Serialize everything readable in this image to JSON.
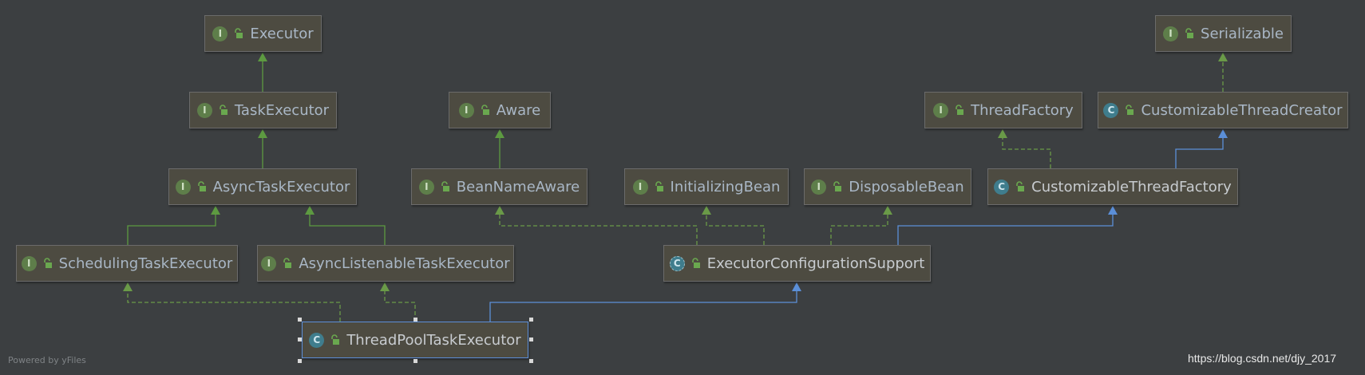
{
  "colors": {
    "extends_edge": "#5d9a41",
    "implements_edge": "#6a9a48",
    "class_extends_edge": "#5b8fd8",
    "node_fill": "#4d4b41",
    "background": "#3c3f41"
  },
  "nodes": {
    "executor": {
      "kind": "interface",
      "badge": "I",
      "label": "Executor"
    },
    "serializable": {
      "kind": "interface",
      "badge": "I",
      "label": "Serializable"
    },
    "task_executor": {
      "kind": "interface",
      "badge": "I",
      "label": "TaskExecutor"
    },
    "aware": {
      "kind": "interface",
      "badge": "I",
      "label": "Aware"
    },
    "thread_factory": {
      "kind": "interface",
      "badge": "I",
      "label": "ThreadFactory"
    },
    "customizable_thread_creator": {
      "kind": "class",
      "badge": "C",
      "label": "CustomizableThreadCreator"
    },
    "async_task_executor": {
      "kind": "interface",
      "badge": "I",
      "label": "AsyncTaskExecutor"
    },
    "bean_name_aware": {
      "kind": "interface",
      "badge": "I",
      "label": "BeanNameAware"
    },
    "initializing_bean": {
      "kind": "interface",
      "badge": "I",
      "label": "InitializingBean"
    },
    "disposable_bean": {
      "kind": "interface",
      "badge": "I",
      "label": "DisposableBean"
    },
    "customizable_thread_factory": {
      "kind": "class",
      "badge": "C",
      "label": "CustomizableThreadFactory"
    },
    "scheduling_task_executor": {
      "kind": "interface",
      "badge": "I",
      "label": "SchedulingTaskExecutor"
    },
    "async_listenable_task_executor": {
      "kind": "interface",
      "badge": "I",
      "label": "AsyncListenableTaskExecutor"
    },
    "executor_configuration_support": {
      "kind": "abstract-class",
      "badge": "C",
      "label": "ExecutorConfigurationSupport"
    },
    "thread_pool_task_executor": {
      "kind": "class",
      "badge": "C",
      "label": "ThreadPoolTaskExecutor",
      "selected": true
    }
  },
  "edges": [
    {
      "from": "thread_pool_task_executor",
      "to": "scheduling_task_executor",
      "type": "implements"
    },
    {
      "from": "thread_pool_task_executor",
      "to": "async_listenable_task_executor",
      "type": "implements"
    },
    {
      "from": "thread_pool_task_executor",
      "to": "executor_configuration_support",
      "type": "extends-class"
    },
    {
      "from": "scheduling_task_executor",
      "to": "async_task_executor",
      "type": "extends"
    },
    {
      "from": "async_listenable_task_executor",
      "to": "async_task_executor",
      "type": "extends"
    },
    {
      "from": "async_task_executor",
      "to": "task_executor",
      "type": "extends"
    },
    {
      "from": "task_executor",
      "to": "executor",
      "type": "extends"
    },
    {
      "from": "bean_name_aware",
      "to": "aware",
      "type": "extends"
    },
    {
      "from": "executor_configuration_support",
      "to": "bean_name_aware",
      "type": "implements"
    },
    {
      "from": "executor_configuration_support",
      "to": "initializing_bean",
      "type": "implements"
    },
    {
      "from": "executor_configuration_support",
      "to": "disposable_bean",
      "type": "implements"
    },
    {
      "from": "executor_configuration_support",
      "to": "customizable_thread_factory",
      "type": "extends-class"
    },
    {
      "from": "customizable_thread_factory",
      "to": "thread_factory",
      "type": "implements"
    },
    {
      "from": "customizable_thread_factory",
      "to": "customizable_thread_creator",
      "type": "extends-class"
    },
    {
      "from": "customizable_thread_creator",
      "to": "serializable",
      "type": "implements"
    }
  ],
  "footer": {
    "powered_by": "Powered by yFiles",
    "watermark": "https://blog.csdn.net/djy_2017"
  }
}
